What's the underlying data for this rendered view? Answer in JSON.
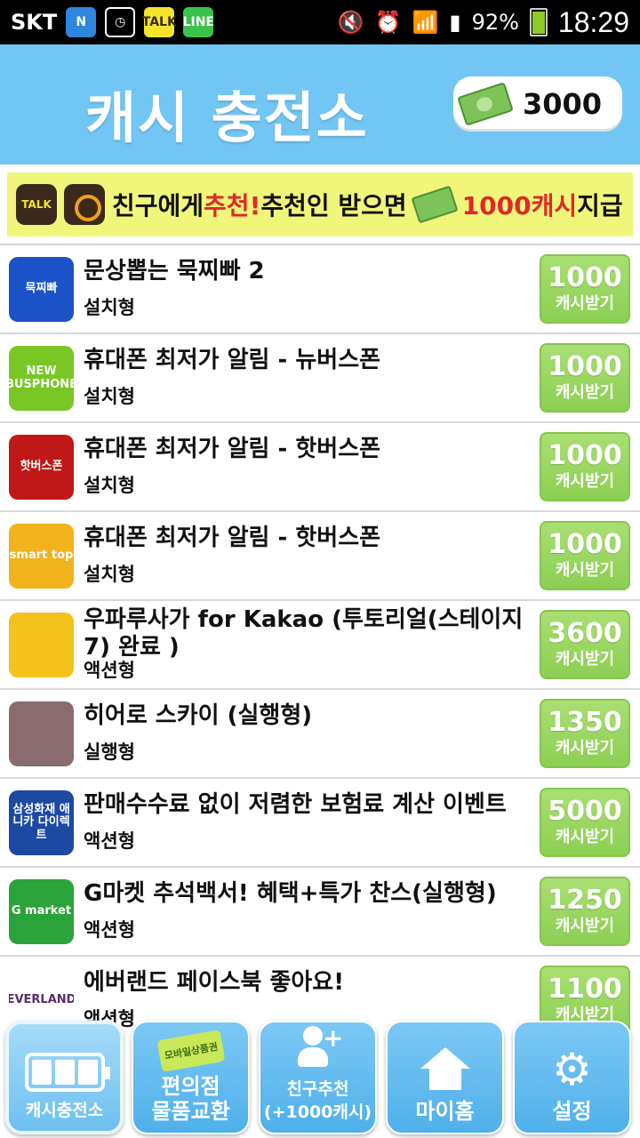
{
  "status_bar": {
    "carrier": "SKT",
    "icons": [
      "naver-n-icon",
      "sim-clock-icon",
      "kakaotalk-icon",
      "line-icon",
      "mute-icon",
      "alarm-icon",
      "wifi-icon",
      "signal-icon"
    ],
    "battery": "92%",
    "time": "18:29"
  },
  "header": {
    "title": "캐시 충전소",
    "cash_amount": "3000"
  },
  "banner": {
    "text_1": "친구에게 ",
    "text_2": "추천!",
    "text_3": " 추천인 받으면",
    "text_4": "1000캐시",
    "text_5": " 지급"
  },
  "offers": [
    {
      "title": "문상뽑는 묵찌빠 2",
      "type": "설치형",
      "reward": "1000",
      "button": "캐시받기",
      "icon_text": "묵찌빠",
      "icon_color": "#1b52c7"
    },
    {
      "title": "휴대폰 최저가 알림 - 뉴버스폰",
      "type": "설치형",
      "reward": "1000",
      "button": "캐시받기",
      "icon_text": "NEW BUSPHONE",
      "icon_color": "#79c724"
    },
    {
      "title": "휴대폰 최저가 알림 - 핫버스폰",
      "type": "설치형",
      "reward": "1000",
      "button": "캐시받기",
      "icon_text": "핫버스폰",
      "icon_color": "#c01818"
    },
    {
      "title": "휴대폰 최저가 알림 - 핫버스폰",
      "type": "설치형",
      "reward": "1000",
      "button": "캐시받기",
      "icon_text": "smart top",
      "icon_color": "#f2b21b"
    },
    {
      "title": "우파루사가 for Kakao (투토리얼(스테이지7) 완료 )",
      "type": "액션형",
      "reward": "3600",
      "button": "캐시받기",
      "icon_text": "",
      "icon_color": "#f4c21a"
    },
    {
      "title": "히어로 스카이 (실행형)",
      "type": "실행형",
      "reward": "1350",
      "button": "캐시받기",
      "icon_text": "",
      "icon_color": "#8a6c70"
    },
    {
      "title": "판매수수료 없이 저렴한 보험료 계산 이벤트",
      "type": "액션형",
      "reward": "5000",
      "button": "캐시받기",
      "icon_text": "삼성화재 애니카 다이렉트",
      "icon_color": "#1c4aa3"
    },
    {
      "title": "G마켓 추석백서! 혜택+특가 찬스(실행형)",
      "type": "액션형",
      "reward": "1250",
      "button": "캐시받기",
      "icon_text": "G market",
      "icon_color": "#2aa33a"
    },
    {
      "title": "에버랜드 페이스북 좋아요!",
      "type": "액션형",
      "reward": "1100",
      "button": "캐시받기",
      "icon_text": "EVERLAND",
      "icon_color": "#ffffff"
    }
  ],
  "tabs": [
    {
      "label": "캐시충전소",
      "icon": "battery-icon",
      "active": true
    },
    {
      "label": "편의점\n물품교환",
      "icon": "coupon-icon",
      "badge": "모바일상품권",
      "active": false
    },
    {
      "label": "친구추천\n(+1000캐시)",
      "icon": "add-friend-icon",
      "active": false
    },
    {
      "label": "마이홈",
      "icon": "home-icon",
      "active": false
    },
    {
      "label": "설정",
      "icon": "gear-icon",
      "active": false
    }
  ],
  "colors": {
    "header_bg": "#72c6f4",
    "banner_bg": "#f0f67a",
    "reward_green": "#9cd864",
    "accent_red": "#e0282a"
  }
}
